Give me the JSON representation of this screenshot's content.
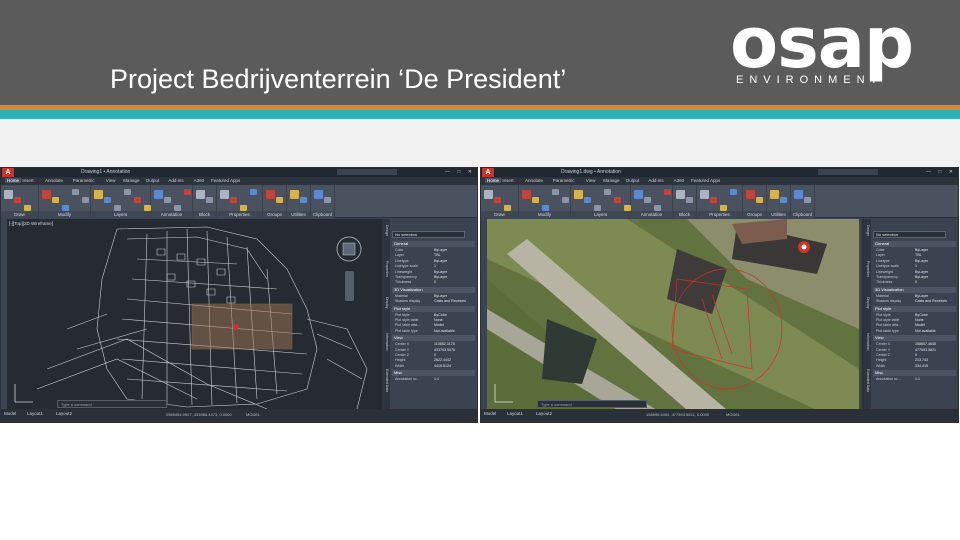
{
  "slide": {
    "title": "Project Bedrijventerrein ‘De President’",
    "logo_word": "osap",
    "logo_sub": "ENVIRONMENT",
    "colors": {
      "header": "#5b5b5b",
      "stripe_orange": "#d98a2b",
      "stripe_teal": "#2fb0b6",
      "cad_dark": "#262b33"
    }
  },
  "left_app": {
    "app_button": "A",
    "doc_title": "Drawing1 • Annotation",
    "tabs": [
      "Home",
      "Insert",
      "Annotate",
      "Parametric",
      "View",
      "Manage",
      "Output",
      "Add-ins",
      "A360",
      "Featured Apps"
    ],
    "groups": [
      "Draw",
      "Modify",
      "Layers",
      "Annotation",
      "Block",
      "Properties",
      "Groups",
      "Utilities",
      "Clipboard"
    ],
    "viewport_label": "[-][Top][2D Wireframe]",
    "command_placeholder": "Type a command",
    "layout_tabs": [
      "Model",
      "Layout1",
      "Layout2"
    ],
    "coords": "2569454.0927, 433986.4473, 0.0000",
    "model_label": "MODEL",
    "palette_tabs": [
      "Design",
      "Properties",
      "Display",
      "Information",
      "Extended Data"
    ],
    "properties": {
      "selection": "No selection",
      "general_header": "General",
      "general_rows": [
        {
          "k": "Color",
          "v": "ByLayer"
        },
        {
          "k": "Layer",
          "v": "TBL"
        },
        {
          "k": "Linetype",
          "v": "ByLayer"
        },
        {
          "k": "Linetype scale",
          "v": "1"
        },
        {
          "k": "Lineweight",
          "v": "ByLayer"
        },
        {
          "k": "Transparency",
          "v": "ByLayer"
        },
        {
          "k": "Thickness",
          "v": "0"
        }
      ],
      "viz_header": "3D Visualization",
      "viz_rows": [
        {
          "k": "Material",
          "v": "ByLayer"
        },
        {
          "k": "Shadow display",
          "v": "Casts and Receives"
        }
      ],
      "plot_header": "Plot style",
      "plot_rows": [
        {
          "k": "Plot style",
          "v": "ByColor"
        },
        {
          "k": "Plot style table",
          "v": "None"
        },
        {
          "k": "Plot table atta...",
          "v": "Model"
        },
        {
          "k": "Plot table type",
          "v": "Not available"
        }
      ],
      "view_header": "View",
      "view_rows": [
        {
          "k": "Center X",
          "v": "110852.3178"
        },
        {
          "k": "Center Y",
          "v": "433743.5076"
        },
        {
          "k": "Center Z",
          "v": "0"
        },
        {
          "k": "Height",
          "v": "2822.4442"
        },
        {
          "k": "Width",
          "v": "4415.5124"
        }
      ],
      "misc_header": "Misc",
      "misc_rows": [
        {
          "k": "Annotation sc...",
          "v": "1:1"
        }
      ]
    }
  },
  "right_app": {
    "app_button": "A",
    "doc_title": "Drawing1.dwg • Annotation",
    "tabs": [
      "Home",
      "Insert",
      "Annotate",
      "Parametric",
      "View",
      "Manage",
      "Output",
      "Add-ins",
      "A360",
      "Featured Apps"
    ],
    "groups": [
      "Draw",
      "Modify",
      "Layers",
      "Annotation",
      "Block",
      "Properties",
      "Groups",
      "Utilities",
      "Clipboard"
    ],
    "viewport_label": "",
    "command_placeholder": "Type a command",
    "layout_tabs": [
      "Model",
      "Layout1",
      "Layout2"
    ],
    "coords": "158596.6492, 477593.5611, 0.0000",
    "model_label": "MODEL",
    "palette_tabs": [
      "Design",
      "Properties",
      "Display",
      "Information",
      "Extended Data"
    ],
    "properties": {
      "selection": "No selection",
      "general_header": "General",
      "general_rows": [
        {
          "k": "Color",
          "v": "ByLayer"
        },
        {
          "k": "Layer",
          "v": "TBL"
        },
        {
          "k": "Linetype",
          "v": "ByLayer"
        },
        {
          "k": "Linetype scale",
          "v": "1"
        },
        {
          "k": "Lineweight",
          "v": "ByLayer"
        },
        {
          "k": "Transparency",
          "v": "ByLayer"
        },
        {
          "k": "Thickness",
          "v": "0"
        }
      ],
      "viz_header": "3D Visualization",
      "viz_rows": [
        {
          "k": "Material",
          "v": "ByLayer"
        },
        {
          "k": "Shadow display",
          "v": "Casts and Receives"
        }
      ],
      "plot_header": "Plot style",
      "plot_rows": [
        {
          "k": "Plot style",
          "v": "ByColor"
        },
        {
          "k": "Plot style table",
          "v": "None"
        },
        {
          "k": "Plot table atta...",
          "v": "Model"
        },
        {
          "k": "Plot table type",
          "v": "Not available"
        }
      ],
      "view_header": "View",
      "view_rows": [
        {
          "k": "Center X",
          "v": "158607.4645"
        },
        {
          "k": "Center Y",
          "v": "477593.5821"
        },
        {
          "k": "Center Z",
          "v": "0"
        },
        {
          "k": "Height",
          "v": "213.743"
        },
        {
          "k": "Width",
          "v": "334.415"
        }
      ],
      "misc_header": "Misc",
      "misc_rows": [
        {
          "k": "Annotation sc...",
          "v": "1:1"
        }
      ]
    }
  }
}
